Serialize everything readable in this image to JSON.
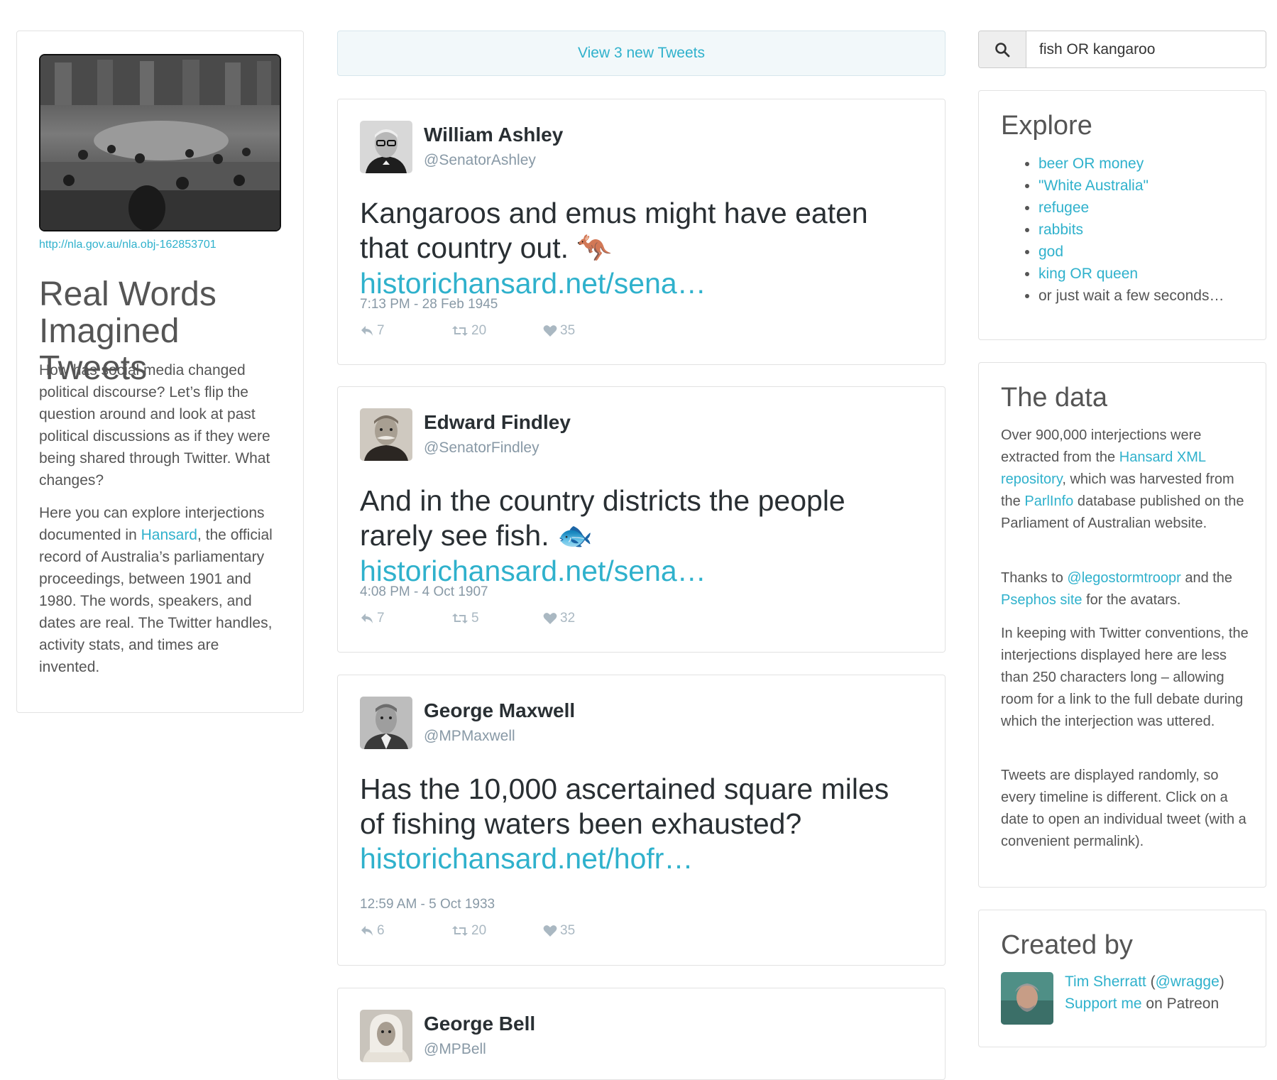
{
  "left": {
    "photo_link": "http://nla.gov.au/nla.obj-162853701",
    "title": "Real Words Imagined Tweets",
    "intro_p1": "How has social media changed political discourse? Let’s flip the question around and look at past political discussions as if they were being shared through Twitter. What changes?",
    "intro_p2_prefix": "Here you can explore interjections documented in ",
    "intro_p2_link": "Hansard",
    "intro_p2_suffix": ", the official record of Australia’s parliamentary proceedings, between 1901 and 1980. The words, speakers, and dates are real. The Twitter handles, activity stats, and times are invented."
  },
  "timeline": {
    "new_tweets_label": "View 3 new Tweets",
    "tweets": [
      {
        "name": "William Ashley",
        "handle": "@SenatorAshley",
        "text": "Kangaroos and emus might have eaten that country out.",
        "emoji": "🦘",
        "link": "historichansard.net/sena…",
        "date": "7:13 PM - 28 Feb 1945",
        "replies": "7",
        "retweets": "20",
        "likes": "35"
      },
      {
        "name": "Edward Findley",
        "handle": "@SenatorFindley",
        "text": "And in the country districts the people rarely see fish.",
        "emoji": "🐟",
        "link": "historichansard.net/sena…",
        "date": "4:08 PM - 4 Oct 1907",
        "replies": "7",
        "retweets": "5",
        "likes": "32"
      },
      {
        "name": "George Maxwell",
        "handle": "@MPMaxwell",
        "text": "Has the 10,000 ascertained square miles of fishing waters been exhausted?",
        "emoji": "",
        "link": "historichansard.net/hofr…",
        "date": "12:59 AM - 5 Oct 1933",
        "replies": "6",
        "retweets": "20",
        "likes": "35"
      },
      {
        "name": "George Bell",
        "handle": "@MPBell"
      }
    ]
  },
  "search": {
    "value": "fish OR kangaroo",
    "icon": "search-icon"
  },
  "explore": {
    "title": "Explore",
    "items": [
      "beer OR money",
      "\"White Australia\"",
      "refugee",
      "rabbits",
      "god",
      "king OR queen"
    ],
    "last_item": "or just wait a few seconds…"
  },
  "data_panel": {
    "title": "The data",
    "p1_a": "Over 900,000 interjections were extracted from the ",
    "p1_link1": "Hansard XML repository",
    "p1_b": ", which was harvested from the ",
    "p1_link2": "ParlInfo",
    "p1_c": " database published on the Parliament of Australian website.",
    "p2_a": "Thanks to ",
    "p2_link1": "@legostormtroopr",
    "p2_b": " and the ",
    "p2_link2": "Psephos site",
    "p2_c": " for the avatars.",
    "p3": "In keeping with Twitter conventions, the interjections displayed here are less than 250 characters long – allowing room for a link to the full debate during which the interjection was uttered.",
    "p4": "Tweets are displayed randomly, so every timeline is different. Click on a date to open an individual tweet (with a convenient permalink)."
  },
  "created": {
    "title": "Created by",
    "author_link": "Tim Sherratt",
    "handle_open": " (",
    "handle_link": "@wragge",
    "handle_close": ")",
    "support_link": "Support me",
    "support_suffix": " on Patreon"
  },
  "colors": {
    "link": "#2fb1cc",
    "text": "#555555",
    "tweet_name": "#292f33",
    "muted": "#8899a6",
    "action": "#aab8c2"
  }
}
